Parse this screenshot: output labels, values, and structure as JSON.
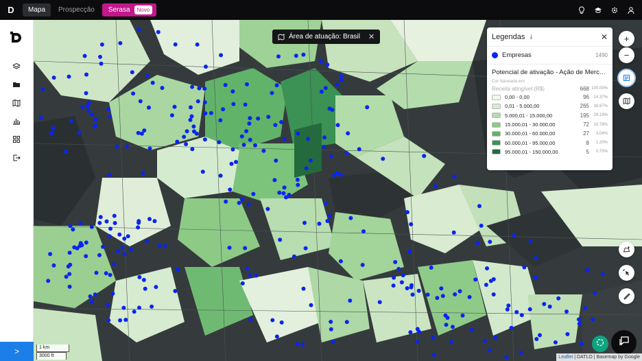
{
  "topbar": {
    "logo": "D",
    "tabs": [
      {
        "label": "Mapa",
        "active": true
      },
      {
        "label": "Prospecção",
        "active": false
      }
    ],
    "serasa_label": "Serasa",
    "serasa_badge": "Novo",
    "icons": [
      "lightbulb-icon",
      "graduation-cap-icon",
      "gear-icon",
      "user-icon"
    ]
  },
  "sidebar": {
    "icons": [
      "layers-icon",
      "folder-icon",
      "map-icon",
      "bar-chart-icon",
      "grid-icon",
      "exit-icon"
    ],
    "expand_label": ">"
  },
  "map": {
    "area_pill": "Área de atuação: Brasil",
    "colors": {
      "background": "#343a3b",
      "companies": "#0a25f0"
    }
  },
  "legend": {
    "title": "Legendas",
    "companies_label": "Empresas",
    "companies_count": "1490",
    "potential_title": "Potencial de ativação - Ação de Mercado ...",
    "color_based_on": "Cor baseada em",
    "metric_label": "Receita atingível (R$)",
    "metric_count": "668",
    "metric_pct": "100.00%",
    "rows": [
      {
        "label": "0,00 - 0,00",
        "count": "96",
        "pct": "14.37%",
        "color": "#f3f7f1"
      },
      {
        "label": "0,01 - 5.000,00",
        "count": "265",
        "pct": "39.67%",
        "color": "#d5ebcf"
      },
      {
        "label": "5.000,01 - 15.000,00",
        "count": "195",
        "pct": "29.19%",
        "color": "#b2dca9"
      },
      {
        "label": "15.000,01 - 30.000,00",
        "count": "72",
        "pct": "10.78%",
        "color": "#8dca86"
      },
      {
        "label": "30.000,01 - 60.000,00",
        "count": "27",
        "pct": "4.04%",
        "color": "#62b36a"
      },
      {
        "label": "60.000,01 - 95.000,00",
        "count": "8",
        "pct": "1.20%",
        "color": "#3c9154"
      },
      {
        "label": "95.000,01 - 150.000,00",
        "count": "5",
        "pct": "0.75%",
        "color": "#236b3d"
      }
    ]
  },
  "map_controls": {
    "zoom_in": "+",
    "zoom_out": "−"
  },
  "scale": {
    "km": "1 km",
    "ft": "3000 ft"
  },
  "attribution": {
    "leaflet": "Leaflet",
    "rest": " | DATLO | Basemap by Google"
  }
}
